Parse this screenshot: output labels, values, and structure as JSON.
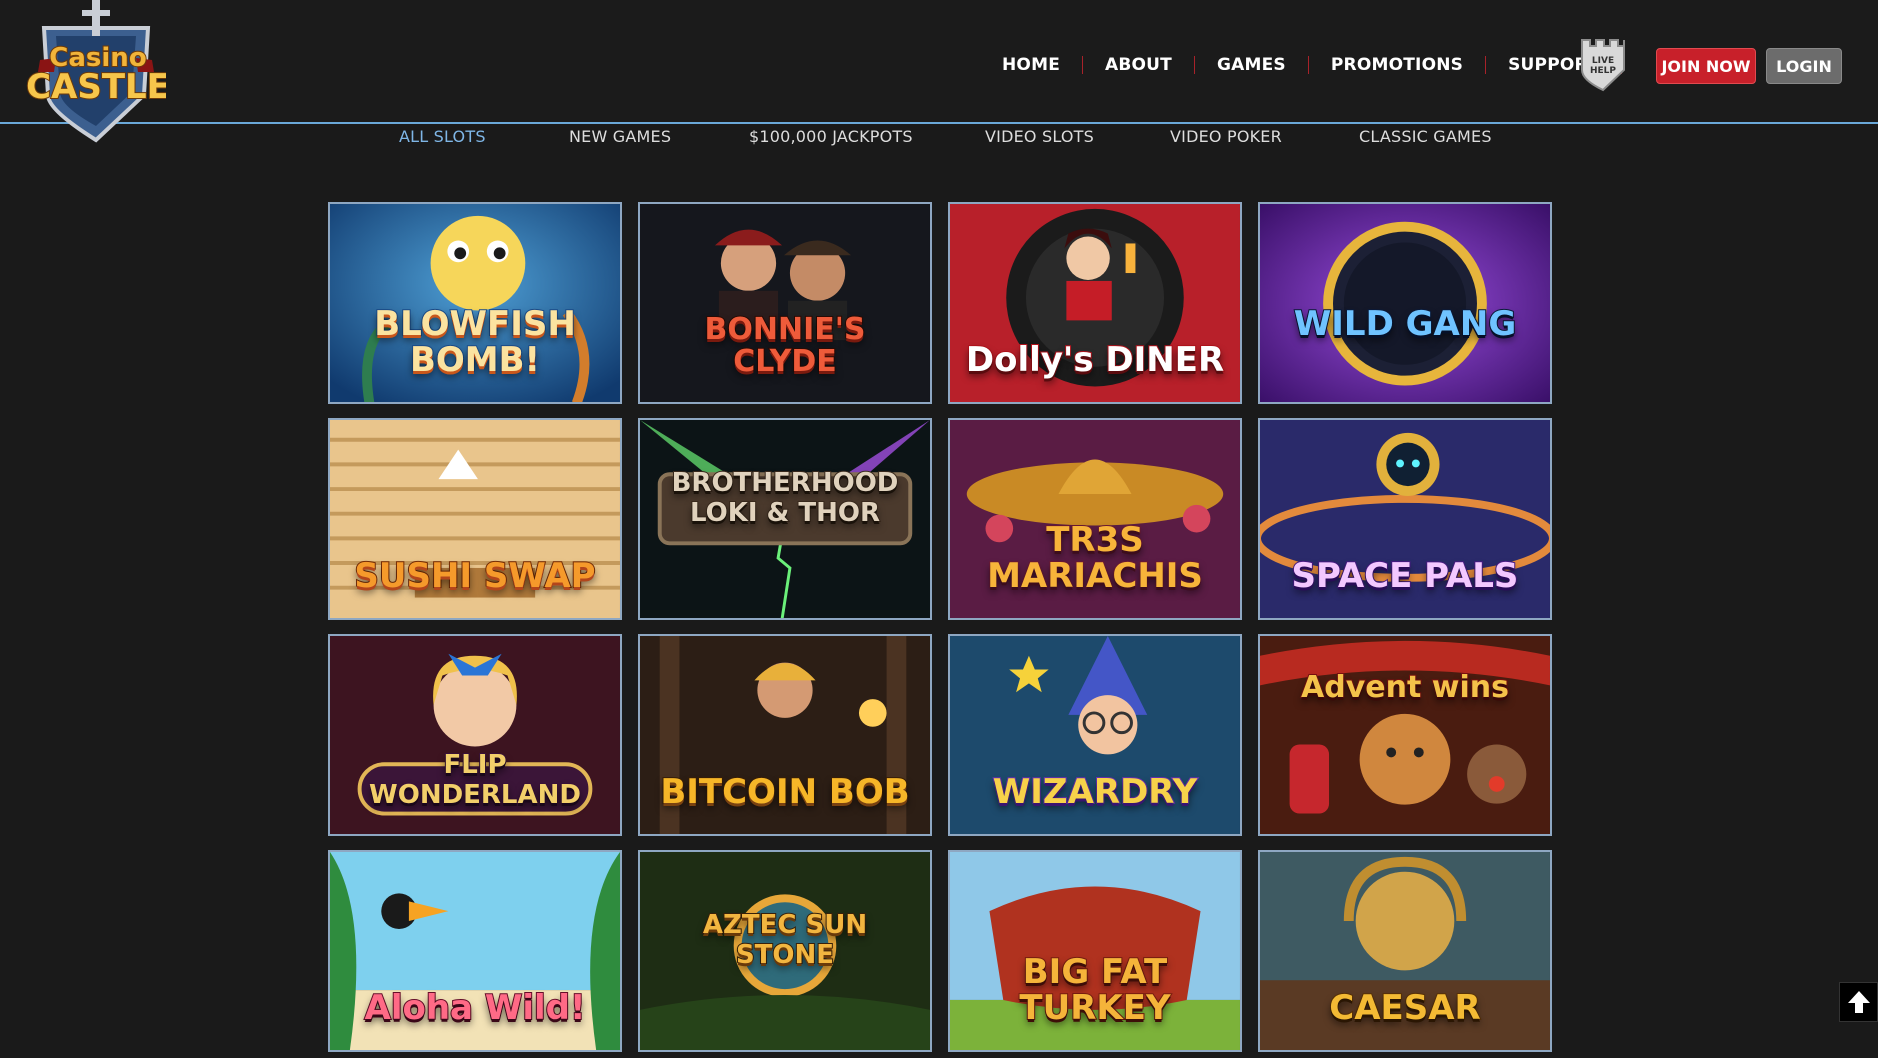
{
  "brand": {
    "logo_line1": "Casino",
    "logo_line2": "CASTLE"
  },
  "nav": {
    "items": [
      "HOME",
      "ABOUT",
      "GAMES",
      "PROMOTIONS",
      "SUPPORT"
    ],
    "live_help": "LIVE HELP",
    "join_label": "JOIN NOW",
    "login_label": "LOGIN"
  },
  "subnav": {
    "items": [
      "ALL SLOTS",
      "NEW GAMES",
      "$100,000 JACKPOTS",
      "VIDEO SLOTS",
      "VIDEO POKER",
      "CLASSIC GAMES"
    ],
    "active": "ALL SLOTS"
  },
  "games": [
    {
      "title": "BLOWFISH BOMB!",
      "icon": "pufferfish-icon"
    },
    {
      "title": "BONNIE'S CLYDE",
      "icon": "gangster-duo-icon"
    },
    {
      "title": "Dolly's DINER",
      "icon": "waitress-icon"
    },
    {
      "title": "WILD GANG",
      "icon": "casino-chip-icon"
    },
    {
      "title": "SUSHI SWAP",
      "icon": "sushi-icon"
    },
    {
      "title": "BROTHERHOOD LOKI & THOR",
      "icon": "lightning-icon"
    },
    {
      "title": "TR3S MARIACHIS",
      "icon": "sombrero-icon"
    },
    {
      "title": "SPACE PALS",
      "icon": "robot-icon"
    },
    {
      "title": "FLIP WONDERLAND",
      "icon": "alice-icon"
    },
    {
      "title": "BITCOIN BOB",
      "icon": "miner-icon"
    },
    {
      "title": "WIZARDRY",
      "icon": "wizard-icon"
    },
    {
      "title": "Advent wins",
      "icon": "gingerbread-icon"
    },
    {
      "title": "Aloha Wild!",
      "icon": "toucan-icon"
    },
    {
      "title": "AZTEC SUN STONE",
      "icon": "sun-stone-icon"
    },
    {
      "title": "BIG FAT TURKEY",
      "icon": "turkey-icon"
    },
    {
      "title": "CAESAR",
      "icon": "laurel-icon"
    }
  ],
  "colors": {
    "accent": "#c8202a",
    "active_link": "#7fb6e6",
    "header_border": "#6aa8d8"
  }
}
